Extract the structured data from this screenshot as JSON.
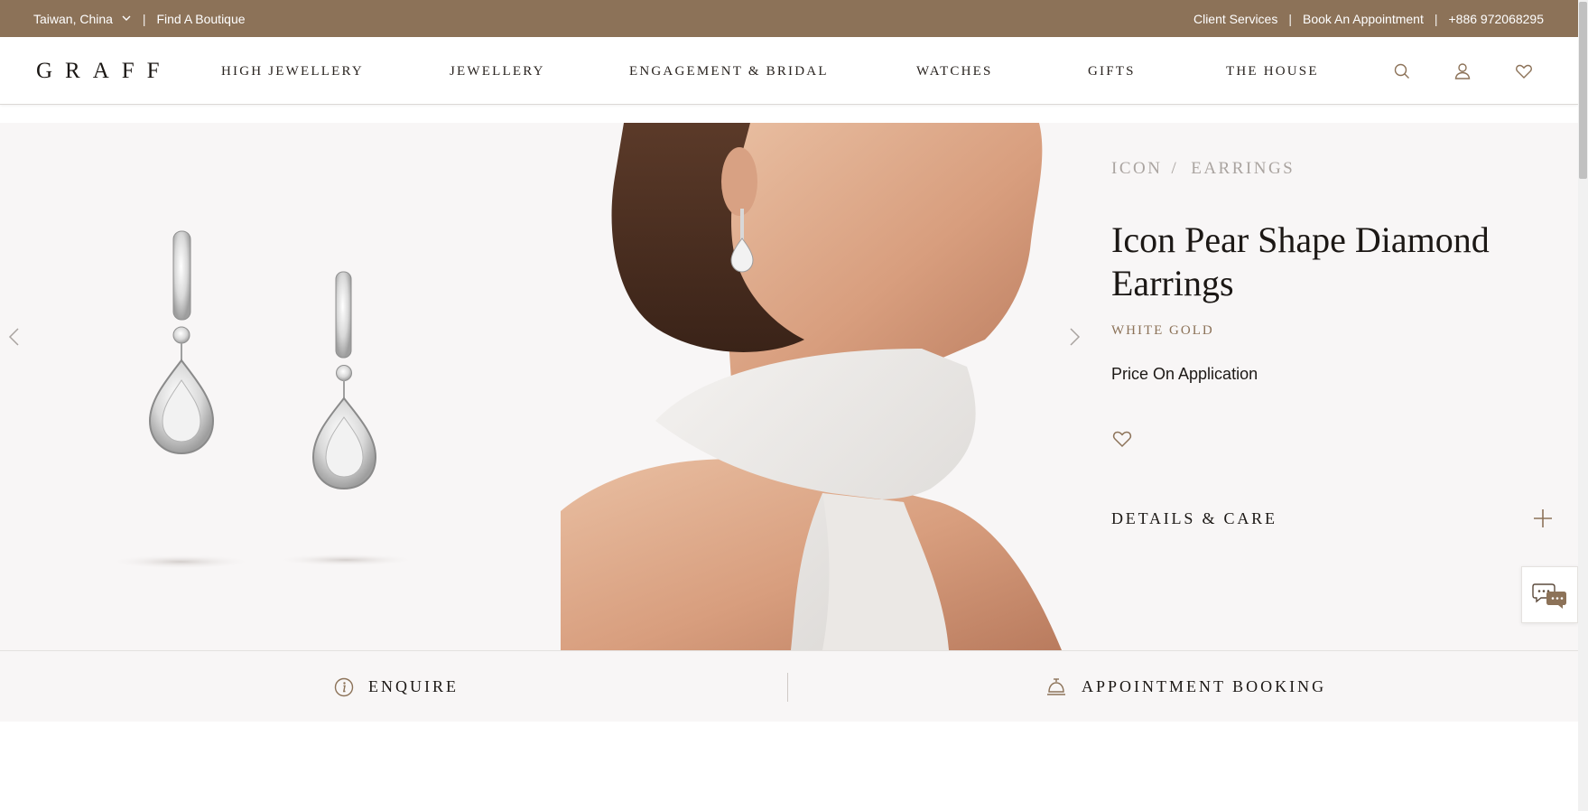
{
  "topbar": {
    "region": "Taiwan, China",
    "find_boutique": "Find A Boutique",
    "client_services": "Client Services",
    "book_appointment": "Book An Appointment",
    "phone": "+886 972068295",
    "separator": "|"
  },
  "header": {
    "logo": "GRAFF",
    "nav": [
      "HIGH JEWELLERY",
      "JEWELLERY",
      "ENGAGEMENT & BRIDAL",
      "WATCHES",
      "GIFTS",
      "THE HOUSE"
    ],
    "icons": [
      "search-icon",
      "account-icon",
      "wishlist-icon"
    ]
  },
  "product": {
    "breadcrumb": [
      "ICON",
      "EARRINGS"
    ],
    "breadcrumb_sep": "/",
    "title": "Icon Pear Shape Diamond Earrings",
    "metal": "WHITE GOLD",
    "price": "Price On Application",
    "details_label": "DETAILS & CARE"
  },
  "actions": {
    "enquire": "ENQUIRE",
    "appointment": "APPOINTMENT BOOKING"
  },
  "colors": {
    "brand_brown": "#8c7258",
    "hero_bg": "#f8f6f6",
    "text_dark": "#1c1815",
    "breadcrumb_gray": "#aaa4a0"
  }
}
